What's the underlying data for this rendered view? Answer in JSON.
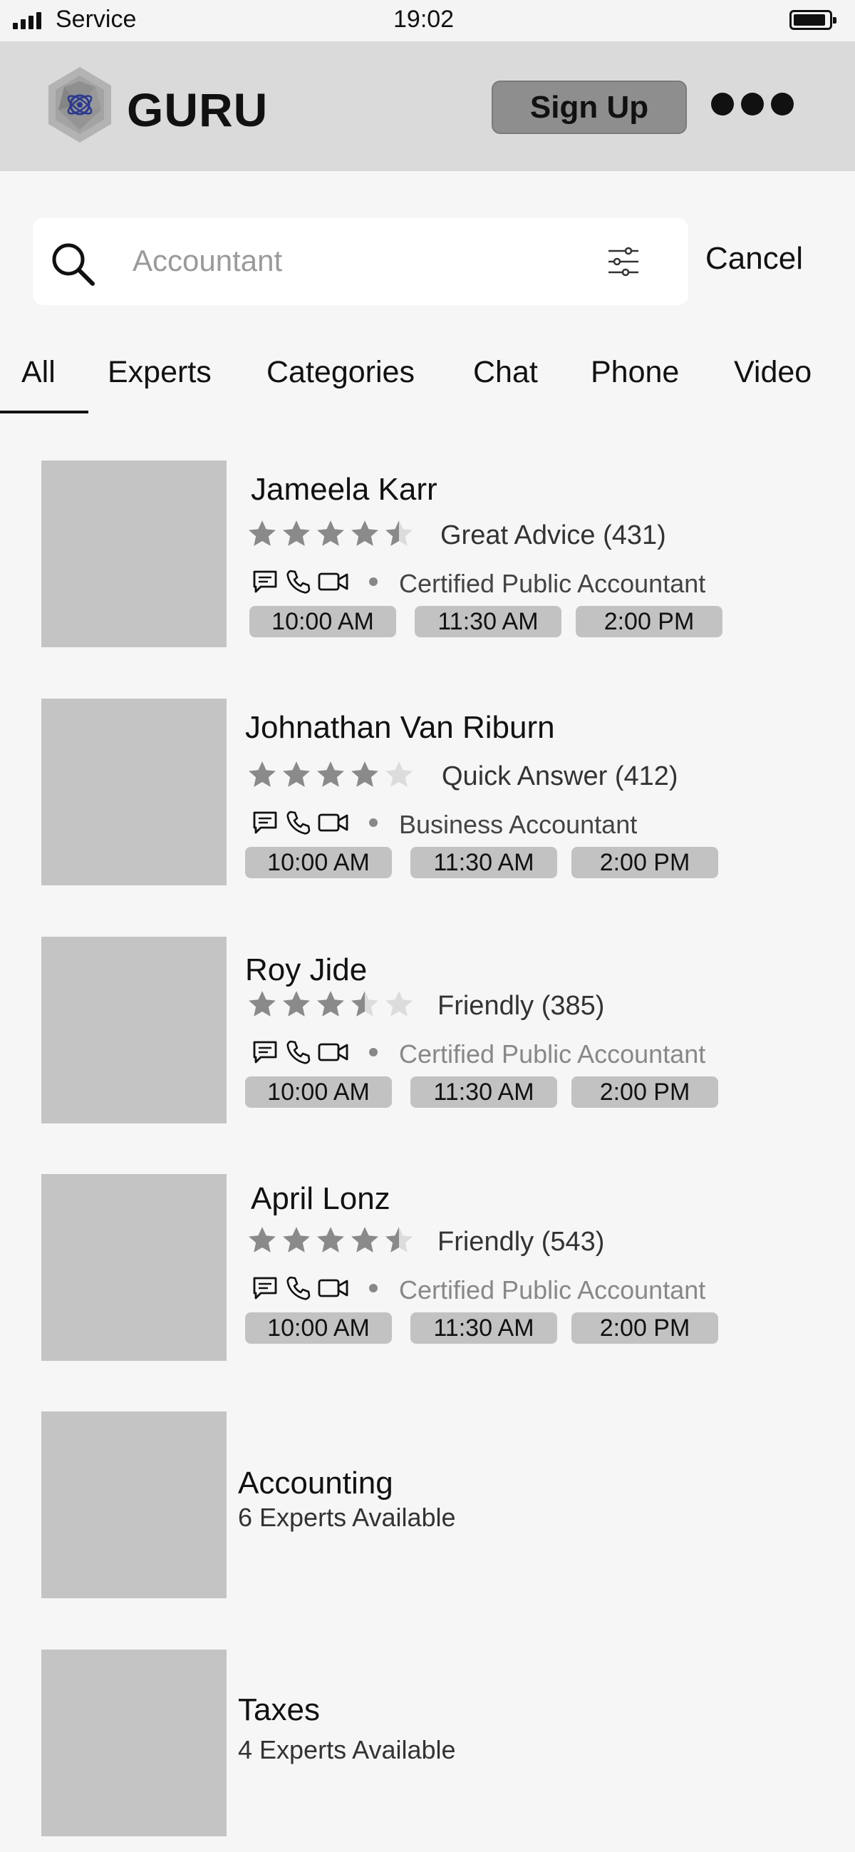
{
  "status_bar": {
    "carrier": "Service",
    "time": "19:02"
  },
  "header": {
    "brand": "GURU",
    "signup_label": "Sign Up"
  },
  "search": {
    "placeholder": "Accountant",
    "cancel_label": "Cancel"
  },
  "tabs": [
    {
      "label": "All"
    },
    {
      "label": "Experts"
    },
    {
      "label": "Categories"
    },
    {
      "label": "Chat"
    },
    {
      "label": "Phone"
    },
    {
      "label": "Video"
    }
  ],
  "selected_tab": "All",
  "experts": [
    {
      "name": "Jameela Karr",
      "rating": 4.5,
      "rating_text": "Great Advice (431)",
      "title": "Certified Public Accountant",
      "slots": [
        "10:00 AM",
        "11:30 AM",
        "2:00 PM"
      ]
    },
    {
      "name": "Johnathan Van Riburn",
      "rating": 4,
      "rating_text": "Quick Answer (412)",
      "title": "Business Accountant",
      "slots": [
        "10:00 AM",
        "11:30 AM",
        "2:00 PM"
      ]
    },
    {
      "name": "Roy Jide",
      "rating": 3.5,
      "rating_text": "Friendly (385)",
      "title": "Certified Public Accountant",
      "slots": [
        "10:00 AM",
        "11:30 AM",
        "2:00 PM"
      ]
    },
    {
      "name": "April Lonz",
      "rating": 4.5,
      "rating_text": "Friendly (543)",
      "title": "Certified Public Accountant",
      "slots": [
        "10:00 AM",
        "11:30 AM",
        "2:00 PM"
      ]
    }
  ],
  "categories": [
    {
      "name": "Accounting",
      "subtitle": "6 Experts Available"
    },
    {
      "name": "Taxes",
      "subtitle": "4 Experts Available"
    }
  ],
  "colors": {
    "header_bg": "#dadada",
    "signup_bg": "#8e8e8e",
    "thumb_bg": "#c4c4c4",
    "slot_bg": "#c2c2c2",
    "star_filled": "#8a8a8a",
    "star_empty": "#dcdcdc"
  }
}
